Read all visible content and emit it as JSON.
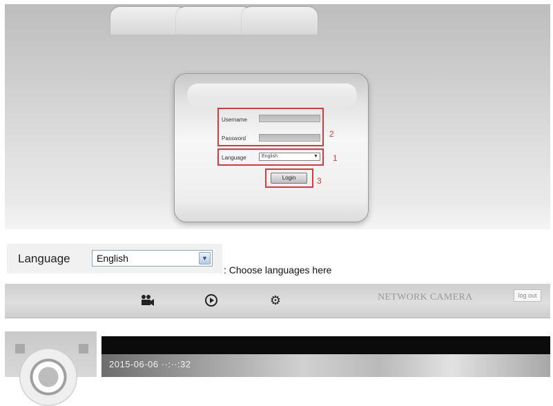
{
  "login": {
    "username_label": "Username",
    "password_label": "Password",
    "language_label": "Language",
    "language_value": "English",
    "login_button": "Login",
    "annotations": [
      "2",
      "1",
      "3"
    ]
  },
  "language_row": {
    "label": "Language",
    "selected": "English",
    "caption": ": Choose languages here"
  },
  "camera_ui": {
    "tabs": [
      "video-camera-icon",
      "play-icon",
      "gear-icon"
    ],
    "brand": "NETWORK CAMERA",
    "logout": "log out",
    "osd_timestamp": "2015-06-06 ··:··:32"
  },
  "colors": {
    "annotation_red": "#d9393b",
    "select_border": "#8fa4c0"
  }
}
